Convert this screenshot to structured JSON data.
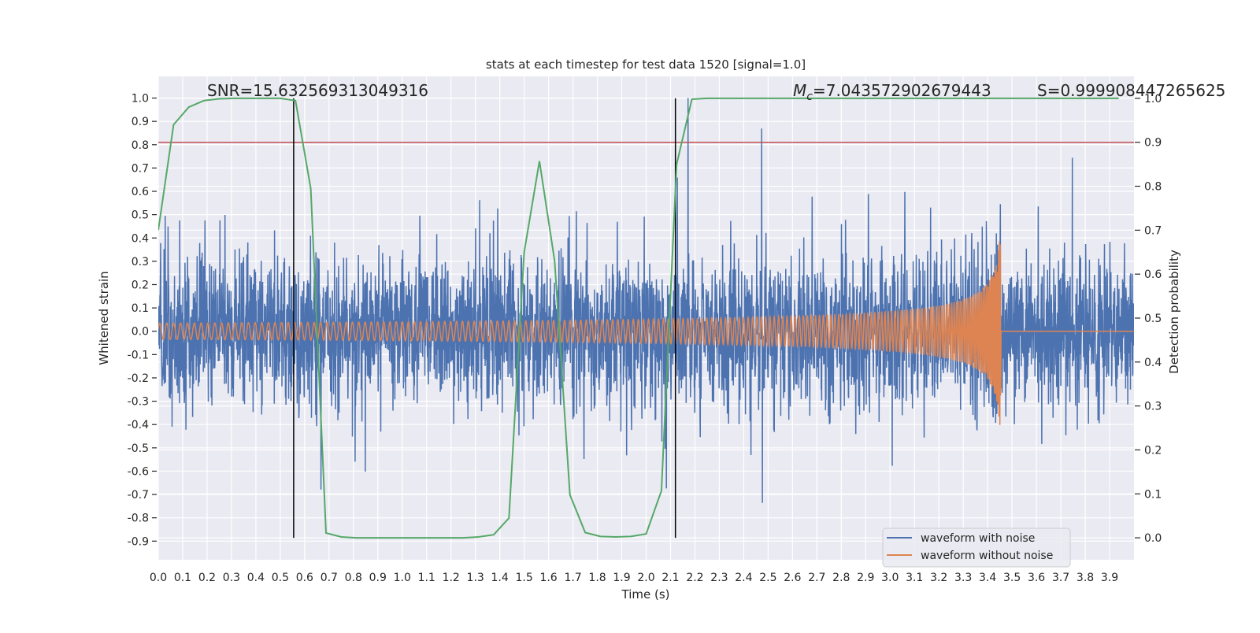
{
  "chart_data": {
    "type": "line",
    "title": "stats at each timestep for test data 1520 [signal=1.0]",
    "xlabel": "Time (s)",
    "ylabel_left": "Whitened strain",
    "ylabel_right": "Detection probability",
    "xlim": [
      0,
      4.0
    ],
    "ylim_left": [
      -0.98,
      1.093
    ],
    "ylim_right": [
      -0.05,
      1.05
    ],
    "grid": true,
    "background": "#eaeaf2",
    "x_ticks": [
      "0.0",
      "0.1",
      "0.2",
      "0.3",
      "0.4",
      "0.5",
      "0.6",
      "0.7",
      "0.8",
      "0.9",
      "1.0",
      "1.1",
      "1.2",
      "1.3",
      "1.4",
      "1.5",
      "1.6",
      "1.7",
      "1.8",
      "1.9",
      "2.0",
      "2.1",
      "2.2",
      "2.3",
      "2.4",
      "2.5",
      "2.6",
      "2.7",
      "2.8",
      "2.9",
      "3.0",
      "3.1",
      "3.2",
      "3.3",
      "3.4",
      "3.5",
      "3.6",
      "3.7",
      "3.8",
      "3.9"
    ],
    "y_ticks_left": [
      "1.0",
      "0.9",
      "0.8",
      "0.7",
      "0.6",
      "0.5",
      "0.4",
      "0.3",
      "0.2",
      "0.1",
      "0.0",
      "-0.1",
      "-0.2",
      "-0.3",
      "-0.4",
      "-0.5",
      "-0.6",
      "-0.7",
      "-0.8",
      "-0.9"
    ],
    "y_ticks_right": [
      "1.0",
      "0.9",
      "0.8",
      "0.7",
      "0.6",
      "0.5",
      "0.4",
      "0.3",
      "0.2",
      "0.1",
      "0.0"
    ],
    "annotations": {
      "snr": "SNR=15.632569313049316",
      "mc_symbol": "M",
      "mc_sub": "c",
      "mc_value": "=7.043572902679443",
      "s": "S=0.999908447265625"
    },
    "legend": {
      "placement": "lower-right",
      "entries": [
        {
          "label": "waveform with noise",
          "color": "#4c72b0"
        },
        {
          "label": "waveform without noise",
          "color": "#dd8452"
        }
      ]
    },
    "series": [
      {
        "name": "waveform with noise",
        "axis": "left",
        "color": "#4c72b0",
        "noise_peak": 1.0
      },
      {
        "name": "waveform without noise",
        "axis": "left",
        "color": "#dd8452",
        "start_amplitude": 0.035,
        "peak_amplitude": 0.42,
        "end_time": 3.455
      },
      {
        "axis": "right",
        "color": "#55a868",
        "x": [
          0,
          0.0625,
          0.125,
          0.1875,
          0.25,
          0.3125,
          0.375,
          0.4375,
          0.5,
          0.5625,
          0.625,
          0.6875,
          0.75,
          0.8125,
          0.875,
          0.9375,
          1.0,
          1.0625,
          1.125,
          1.1875,
          1.25,
          1.3125,
          1.375,
          1.4375,
          1.5,
          1.5625,
          1.625,
          1.6875,
          1.75,
          1.8125,
          1.875,
          1.9375,
          2.0,
          2.0625,
          2.125,
          2.1875,
          2.25,
          2.3125,
          2.375,
          2.4375,
          2.5,
          2.5625,
          2.625,
          2.6875,
          2.75,
          2.8125,
          2.875,
          2.9375,
          3.0,
          3.0625,
          3.125,
          3.1875,
          3.25,
          3.3125,
          3.375,
          3.4375,
          3.5,
          3.5625,
          3.625,
          3.6875,
          3.75,
          3.8125,
          3.875,
          3.9375
        ],
        "values": [
          0.7,
          0.94,
          0.98,
          0.995,
          0.999,
          1.0,
          1.0,
          1.0,
          1.0,
          0.995,
          0.795,
          0.011,
          0.002,
          0.0,
          0.0,
          0.0,
          0.0,
          0.0,
          0.0,
          0.0,
          0.0,
          0.002,
          0.007,
          0.045,
          0.65,
          0.857,
          0.63,
          0.098,
          0.012,
          0.003,
          0.002,
          0.003,
          0.009,
          0.107,
          0.85,
          0.998,
          1.0,
          1.0,
          1.0,
          1.0,
          1.0,
          1.0,
          1.0,
          1.0,
          1.0,
          1.0,
          1.0,
          1.0,
          1.0,
          1.0,
          1.0,
          1.0,
          1.0,
          1.0,
          1.0,
          1.0,
          1.0,
          1.0,
          1.0,
          1.0,
          1.0,
          1.0,
          1.0,
          1.0
        ]
      }
    ],
    "threshold": {
      "axis": "right",
      "value": 0.9,
      "color": "#c44e52"
    },
    "vertical_lines": {
      "axis": "right",
      "x": [
        0.555,
        2.12
      ],
      "from": 0.0,
      "to": 1.0,
      "color": "#000000"
    }
  }
}
